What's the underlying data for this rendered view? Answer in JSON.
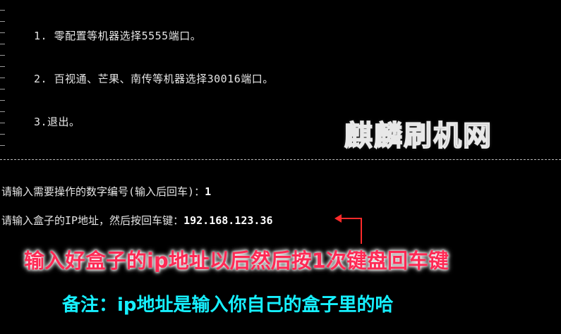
{
  "menu": {
    "items": [
      {
        "label": "1. 零配置等机器选择5555端口。"
      },
      {
        "label": "2. 百视通、芒果、南传等机器选择30016端口。"
      },
      {
        "label": "3.退出。"
      }
    ]
  },
  "watermark": "麒麟刷机网",
  "prompts": {
    "number_prompt": "请输入需要操作的数字编号(输入后回车)：",
    "number_value": "1",
    "ip_prompt": "请输入盒子的IP地址，然后按回车键：",
    "ip_value": "192.168.123.36"
  },
  "annotations": {
    "instruction": "输入好盒子的ip地址以后然后按1次键盘回车键",
    "note": "备注：ip地址是输入你自己的盒子里的哈"
  },
  "colors": {
    "background": "#000000",
    "terminal_text": "#e6e6e6",
    "arrow": "#ff2a2a",
    "instruction_text": "#ff2a55",
    "note_text": "#16f0ff"
  }
}
